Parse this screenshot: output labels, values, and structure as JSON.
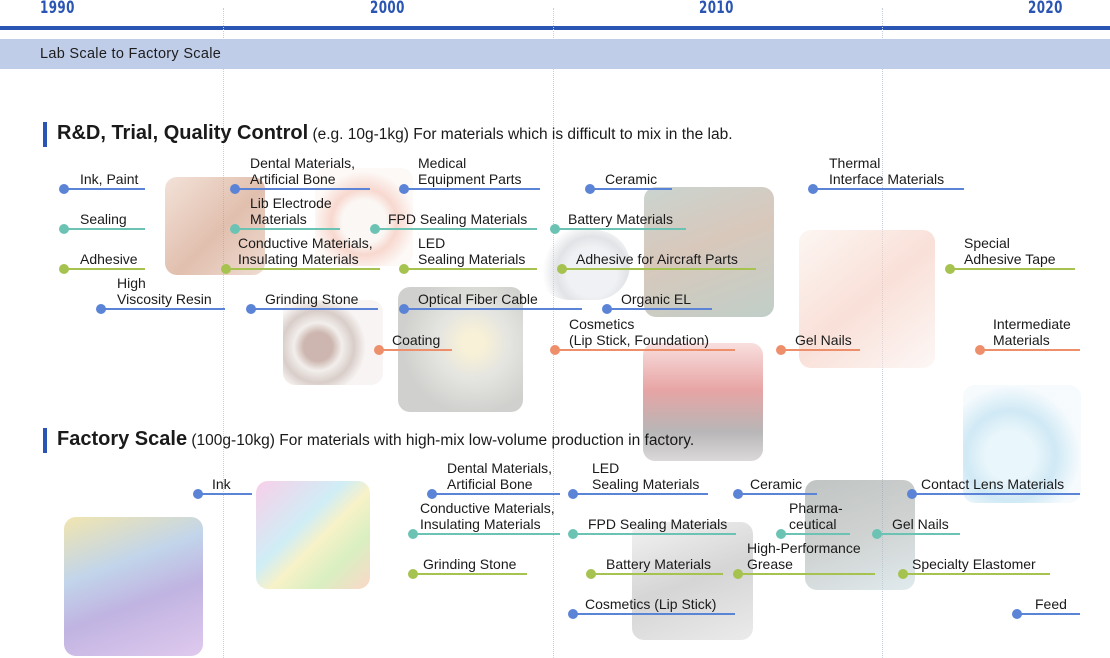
{
  "timeline": {
    "years": [
      "1990",
      "2000",
      "2010",
      "2020"
    ],
    "band_label": "Lab Scale to Factory Scale",
    "colors": {
      "axis": "#2a55b3",
      "band": "#bfcde9",
      "blue": "#5b83d6",
      "teal": "#6cc3b4",
      "green": "#a6c24f",
      "orange": "#ee8f6c"
    }
  },
  "sections": {
    "rd": {
      "title": "R&D, Trial, Quality Control",
      "subtitle": " (e.g. 10g-1kg) For materials which is difficult to mix in the lab.",
      "items": [
        {
          "label": "Ink, Paint",
          "color": "blue"
        },
        {
          "label": "Sealing",
          "color": "teal"
        },
        {
          "label": "Adhesive",
          "color": "green"
        },
        {
          "label": "High\nViscosity Resin",
          "color": "blue"
        },
        {
          "label": "Dental Materials,\nArtificial Bone",
          "color": "blue"
        },
        {
          "label": "Lib Electrode\nMaterials",
          "color": "teal"
        },
        {
          "label": "Conductive Materials,\nInsulating Materials",
          "color": "green"
        },
        {
          "label": "Grinding Stone",
          "color": "blue"
        },
        {
          "label": "Medical\nEquipment Parts",
          "color": "blue"
        },
        {
          "label": "FPD Sealing Materials",
          "color": "teal"
        },
        {
          "label": "LED\nSealing Materials",
          "color": "green"
        },
        {
          "label": "Optical Fiber Cable",
          "color": "blue"
        },
        {
          "label": "Coating",
          "color": "orange"
        },
        {
          "label": "Ceramic",
          "color": "blue"
        },
        {
          "label": "Battery Materials",
          "color": "teal"
        },
        {
          "label": "Adhesive for Aircraft Parts",
          "color": "green"
        },
        {
          "label": "Organic EL",
          "color": "blue"
        },
        {
          "label": "Cosmetics\n(Lip Stick, Foundation)",
          "color": "orange"
        },
        {
          "label": "Thermal\nInterface Materials",
          "color": "blue"
        },
        {
          "label": "Special\nAdhesive Tape",
          "color": "green"
        },
        {
          "label": "Gel Nails",
          "color": "orange"
        },
        {
          "label": "Intermediate\nMaterials",
          "color": "orange"
        }
      ]
    },
    "factory": {
      "title": "Factory Scale",
      "subtitle": " (100g-10kg) For materials with high-mix low-volume production in factory.",
      "items": [
        {
          "label": "Ink",
          "color": "blue"
        },
        {
          "label": "Dental Materials,\nArtificial Bone",
          "color": "blue"
        },
        {
          "label": "Conductive Materials,\nInsulating Materials",
          "color": "teal"
        },
        {
          "label": "Grinding Stone",
          "color": "green"
        },
        {
          "label": "LED\nSealing Materials",
          "color": "blue"
        },
        {
          "label": "FPD Sealing Materials",
          "color": "teal"
        },
        {
          "label": "Battery Materials",
          "color": "green"
        },
        {
          "label": "Cosmetics (Lip Stick)",
          "color": "blue"
        },
        {
          "label": "Ceramic",
          "color": "blue"
        },
        {
          "label": "Pharma-\nceutical",
          "color": "teal"
        },
        {
          "label": "High-Performance\nGrease",
          "color": "green"
        },
        {
          "label": "Contact Lens Materials",
          "color": "blue"
        },
        {
          "label": "Gel Nails",
          "color": "teal"
        },
        {
          "label": "Specialty Elastomer",
          "color": "green"
        },
        {
          "label": "Feed",
          "color": "blue"
        }
      ]
    }
  },
  "photos": [
    {
      "name": "copper-wire-photo"
    },
    {
      "name": "dentures-photo"
    },
    {
      "name": "batteries-photo"
    },
    {
      "name": "circuit-components-photo"
    },
    {
      "name": "nails-photo"
    },
    {
      "name": "grinding-stone-photo"
    },
    {
      "name": "led-photo"
    },
    {
      "name": "lipstick-photo"
    },
    {
      "name": "contact-lens-photo"
    },
    {
      "name": "pigment-jars-photo"
    },
    {
      "name": "paint-wells-photo"
    },
    {
      "name": "tablet-device-photo"
    },
    {
      "name": "circuit-board-photo"
    }
  ]
}
